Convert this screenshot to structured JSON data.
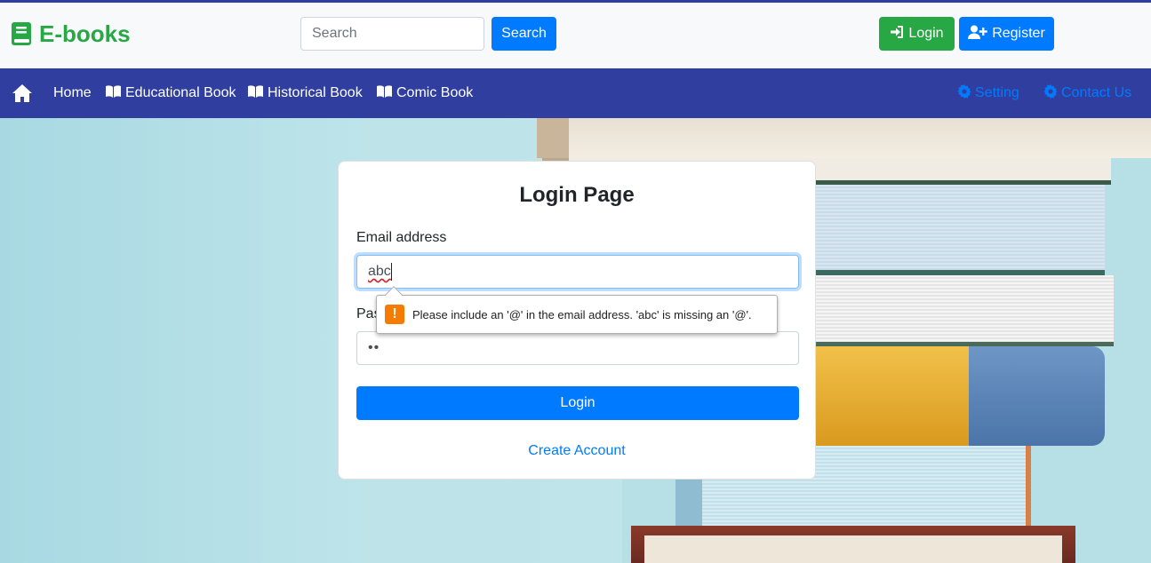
{
  "header": {
    "brand": "E-books",
    "search_placeholder": "Search",
    "search_button": "Search",
    "login_button": "Login",
    "register_button": "Register"
  },
  "navbar": {
    "items": [
      "Home",
      "Educational Book",
      "Historical Book",
      "Comic Book"
    ],
    "right_items": [
      "Setting",
      "Contact Us"
    ]
  },
  "login_form": {
    "title": "Login Page",
    "email_label": "Email address",
    "email_value": "abc",
    "password_label": "Pas",
    "password_value": "••",
    "login_button": "Login",
    "create_account": "Create Account"
  },
  "validation_tooltip": {
    "message": "Please include an '@' in the email address. 'abc' is missing an '@'."
  },
  "colors": {
    "brand": "#28a745",
    "primary": "#007bff",
    "navbar": "#303f9f",
    "warning": "#f57c00"
  }
}
